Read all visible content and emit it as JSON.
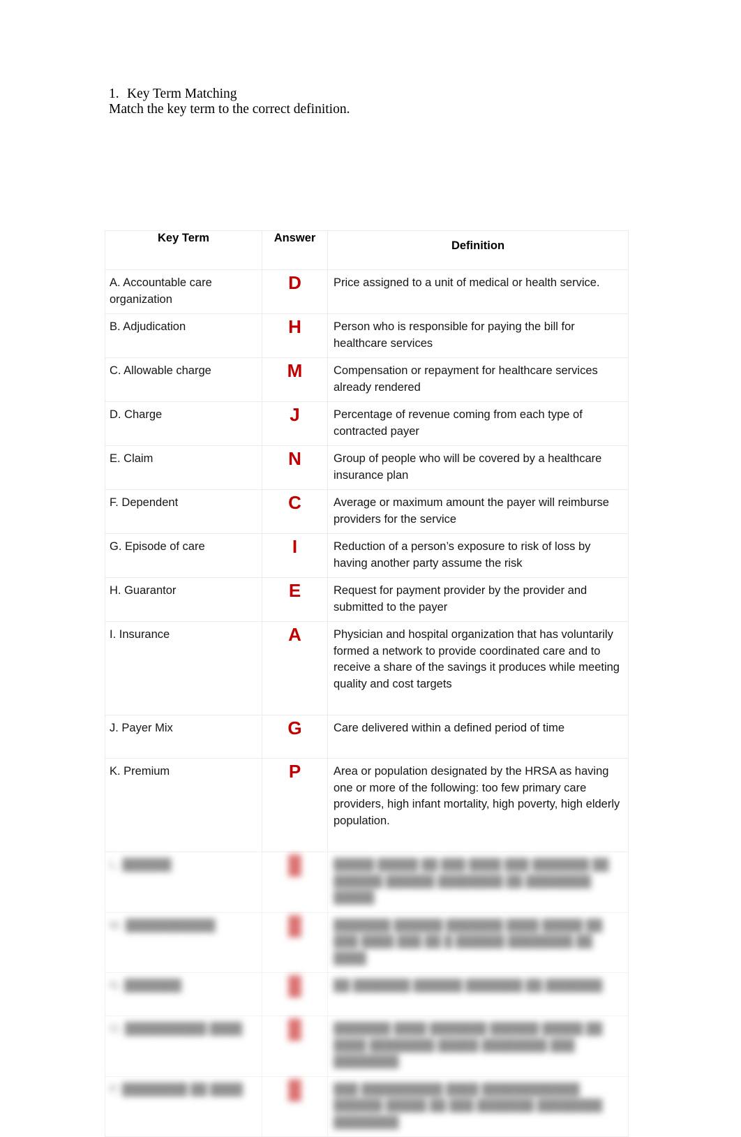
{
  "document": {
    "prompt": {
      "number": "1.",
      "title": "Key Term Matching",
      "instruction": "Match the key term to the correct definition."
    },
    "table": {
      "headers": {
        "key_term": "Key Term",
        "answer": "Answer",
        "definition": "Definition"
      },
      "answer_color": "#C00000",
      "rows": [
        {
          "key_term": "A. Accountable care organization",
          "answer": "D",
          "definition": "Price assigned to a unit of medical or health service.",
          "legible": true
        },
        {
          "key_term": "B. Adjudication",
          "answer": "H",
          "definition": "Person who is responsible for paying the bill for healthcare services",
          "legible": true
        },
        {
          "key_term": "C. Allowable charge",
          "answer": "M",
          "definition": "Compensation or repayment for healthcare services already rendered",
          "legible": true
        },
        {
          "key_term": "D. Charge",
          "answer": "J",
          "definition": "Percentage of revenue coming from each type of contracted payer",
          "legible": true
        },
        {
          "key_term": "E. Claim",
          "answer": "N",
          "definition": "Group of people who will be covered by a healthcare insurance plan",
          "legible": true
        },
        {
          "key_term": "F. Dependent",
          "answer": "C",
          "definition": "Average or maximum amount the payer will reimburse providers for the service",
          "legible": true
        },
        {
          "key_term": "G. Episode of care",
          "answer": "I",
          "definition": "Reduction of a person’s exposure to risk of loss by having another party assume the risk",
          "legible": true
        },
        {
          "key_term": "H. Guarantor",
          "answer": "E",
          "definition": "Request for payment provider by the provider and submitted to the payer",
          "legible": true
        },
        {
          "key_term": "I. Insurance",
          "answer": "A",
          "definition": "Physician and hospital organization that has voluntarily formed a network to provide coordinated care and to receive a share of the savings it produces while meeting quality and cost targets",
          "legible": true
        },
        {
          "key_term": "J. Payer Mix",
          "answer": "G",
          "definition": "Care delivered within a defined period of time",
          "legible": true
        },
        {
          "key_term": "K. Premium",
          "answer": "P",
          "definition": "Area or population designated by the HRSA as having one or more of the following: too few primary care providers, high infant mortality, high poverty, high elderly population.",
          "legible": true
        },
        {
          "key_term": "L. ██████",
          "answer": "█",
          "definition": "█████ █████ ██ ███ ████ ███ ███████ ██ ██████ ██████ ████████ ██ ████████ █████",
          "legible": false
        },
        {
          "key_term": "M. ███████████",
          "answer": "█",
          "definition": "███████ ██████ ███████ ████ █████ ██ ███ ████ ███ ██ █ ██████ ████████ ██ ████",
          "legible": false
        },
        {
          "key_term": "N. ███████",
          "answer": "█",
          "definition": "██ ███████ ██████ ███████ ██ ███████",
          "legible": false
        },
        {
          "key_term": "O. ██████████ ████",
          "answer": "█",
          "definition": "███████ ████ ███████ ██████ █████ ██ ████ ████████ █████ ████████ ███ ████████",
          "legible": false
        },
        {
          "key_term": "P. ████████ ██ ████",
          "answer": "█",
          "definition": "███ ██████████ ████ ████████████ ██████ █████ ██ ███ ███████ ████████ ████████",
          "legible": false
        }
      ]
    }
  }
}
